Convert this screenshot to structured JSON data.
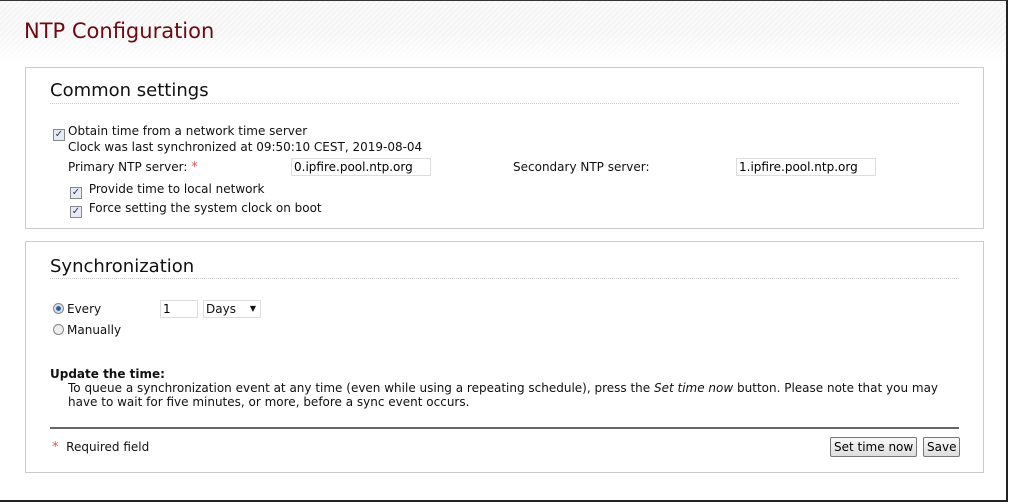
{
  "page": {
    "title": "NTP Configuration"
  },
  "common": {
    "heading": "Common settings",
    "obtain_label": "Obtain time from a network time server",
    "obtain_checked": true,
    "last_sync": "Clock was last synchronized at 09:50:10 CEST, 2019-08-04",
    "primary_label": "Primary NTP server:",
    "primary_value": "0.ipfire.pool.ntp.org",
    "secondary_label": "Secondary NTP server:",
    "secondary_value": "1.ipfire.pool.ntp.org",
    "provide_label": "Provide time to local network",
    "provide_checked": true,
    "force_label": "Force setting the system clock on boot",
    "force_checked": true,
    "required_marker": "*"
  },
  "sync": {
    "heading": "Synchronization",
    "every_label": "Every",
    "every_selected": true,
    "manual_label": "Manually",
    "interval_value": "1",
    "unit_value": "Days",
    "update_heading": "Update the time:",
    "update_text_1": "To queue a synchronization event at any time (even while using a repeating schedule), press the ",
    "update_text_em": "Set time now",
    "update_text_2": " button. Please note that you may",
    "update_text_3": "have to wait for five minutes, or more, before a sync event occurs.",
    "required_marker": "*",
    "required_label": "Required field",
    "set_time_button": "Set time now",
    "save_button": "Save"
  },
  "colors": {
    "title": "#6e0a12",
    "required": "#dd5555"
  }
}
